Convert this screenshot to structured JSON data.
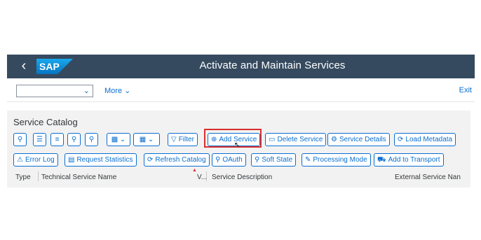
{
  "shell": {
    "title": "Activate and Maintain Services",
    "logo_text": "SAP",
    "back_icon": "chevron-left-icon",
    "brand_color": "#354a5f"
  },
  "subheader": {
    "select_value": "",
    "more_label": "More",
    "exit_label": "Exit"
  },
  "catalog": {
    "title": "Service Catalog",
    "toolbar_row1": [
      {
        "icon": "zoom-icon"
      },
      {
        "icon": "align-top-icon"
      },
      {
        "icon": "filter-list-icon"
      },
      {
        "icon": "search-icon"
      },
      {
        "icon": "search-next-icon"
      },
      {
        "icon": "export-dropdown-icon"
      },
      {
        "icon": "layout-dropdown-icon"
      },
      {
        "label": "Filter",
        "icon": "filter-icon"
      },
      {
        "label": "Add Service",
        "icon": "add-icon"
      },
      {
        "label": "Delete Service",
        "icon": "trash-icon"
      },
      {
        "label": "Service Details",
        "icon": "details-icon"
      },
      {
        "label": "Load Metadata",
        "icon": "refresh-icon"
      }
    ],
    "toolbar_row2": [
      {
        "label": "Error Log",
        "icon": "error-icon"
      },
      {
        "label": "Request Statistics",
        "icon": "chart-icon"
      },
      {
        "label": "Refresh Catalog",
        "icon": "refresh-icon"
      },
      {
        "label": "OAuth",
        "icon": "key-icon"
      },
      {
        "label": "Soft State",
        "icon": "key-icon"
      },
      {
        "label": "Processing Mode",
        "icon": "edit-icon"
      },
      {
        "label": "Add to Transport",
        "icon": "truck-icon"
      }
    ],
    "columns": [
      "Type",
      "Technical Service Name",
      "V...",
      "Service Description",
      "External Service Nan"
    ]
  },
  "highlight_color": "#d9302e"
}
